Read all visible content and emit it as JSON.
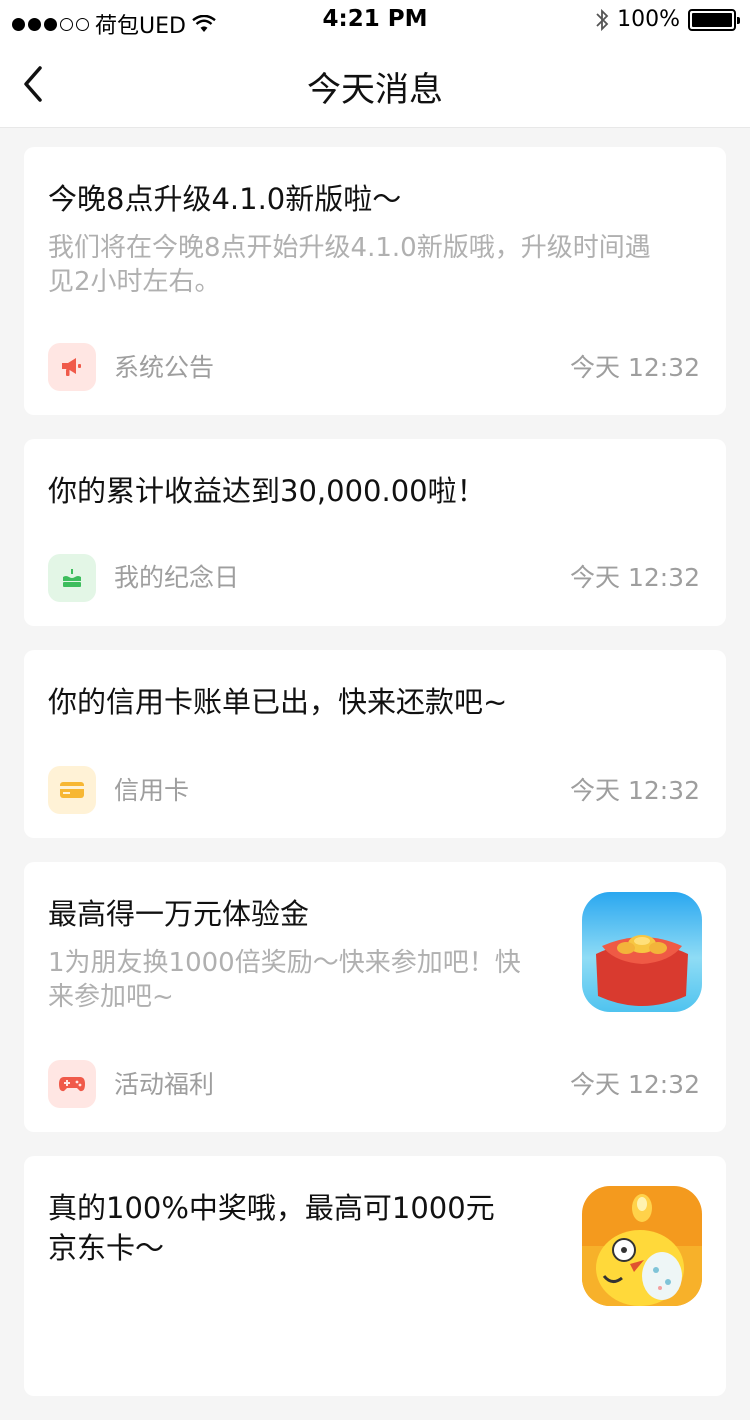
{
  "status": {
    "carrier": "荷包UED",
    "time": "4:21 PM",
    "battery": "100%"
  },
  "nav": {
    "title": "今天消息"
  },
  "messages": [
    {
      "title": "今晚8点升级4.1.0新版啦～",
      "desc_line1": "我们将在今晚8点开始升级4.1.0新版哦，升级时间遇",
      "desc_line2": "见2小时左右。",
      "category": "系统公告",
      "time": "今天 12:32",
      "icon": "megaphone-icon",
      "color": "#f05a4a"
    },
    {
      "title": "你的累计收益达到30,000.00啦！",
      "category": "我的纪念日",
      "time": "今天 12:32",
      "icon": "cake-icon",
      "color": "#3dbd5d"
    },
    {
      "title": "你的信用卡账单已出，快来还款吧~",
      "category": "信用卡",
      "time": "今天 12:32",
      "icon": "credit-card-icon",
      "color": "#f7b733"
    },
    {
      "title": "最高得一万元体验金",
      "desc_line1": "1为朋友换1000倍奖励～快来参加吧！快",
      "desc_line2": "来参加吧~",
      "category": "活动福利",
      "time": "今天 12:32",
      "icon": "gamepad-icon",
      "color": "#f05a4a",
      "thumb": "red-envelope-icon"
    },
    {
      "title_line1": "真的100%中奖哦，最高可1000元",
      "title_line2": "京东卡～",
      "thumb": "chick-mascot-icon"
    }
  ]
}
